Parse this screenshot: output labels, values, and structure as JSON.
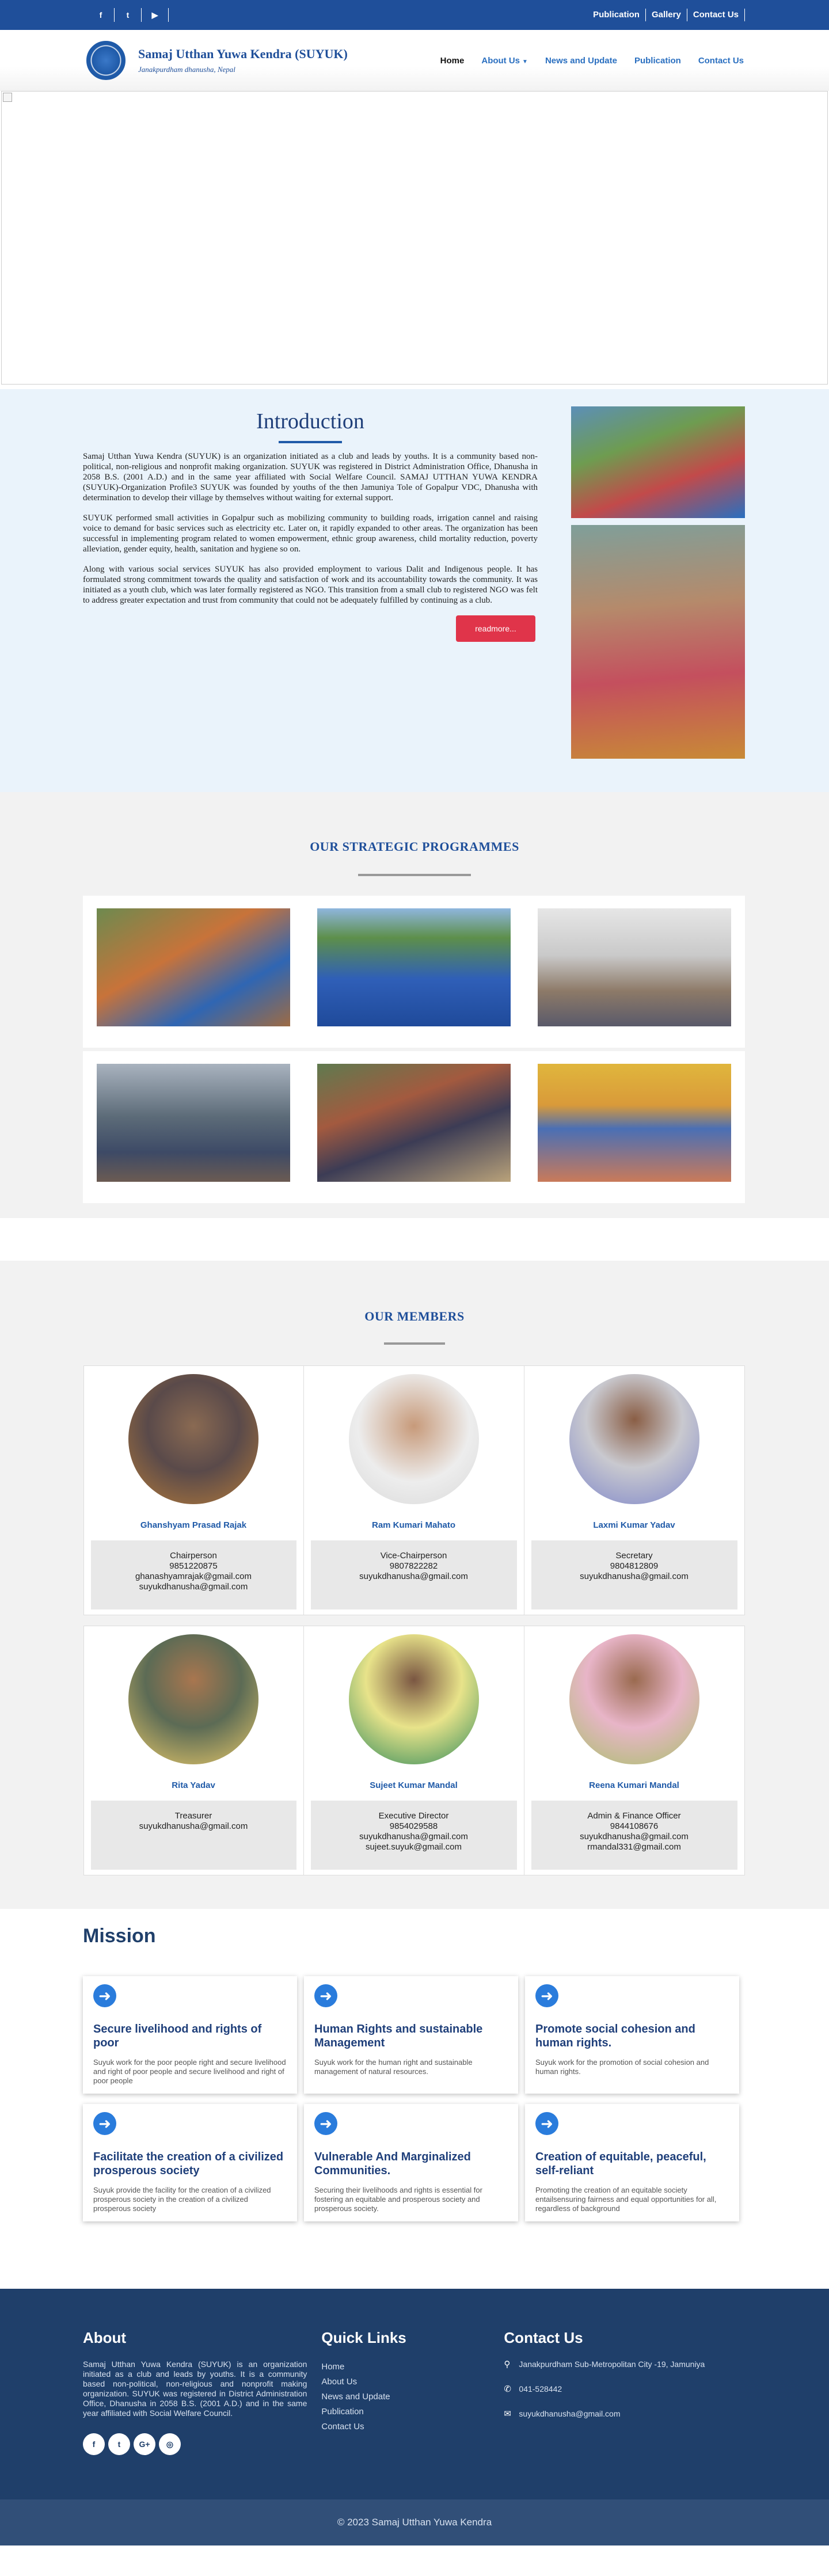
{
  "topbar": {
    "social": [
      {
        "icon": "facebook-icon",
        "glyph": "f"
      },
      {
        "icon": "twitter-icon",
        "glyph": "t"
      },
      {
        "icon": "youtube-icon",
        "glyph": "▶"
      }
    ],
    "links": [
      "Publication",
      "Gallery",
      "Contact Us"
    ]
  },
  "brand": {
    "title": "Samaj Utthan Yuwa Kendra (SUYUK)",
    "subtitle": "Janakpurdham dhanusha, Nepal"
  },
  "nav": {
    "items": [
      "Home",
      "About Us",
      "News and Update",
      "Publication",
      "Contact Us"
    ]
  },
  "intro": {
    "title": "Introduction",
    "paragraphs": [
      "Samaj Utthan Yuwa Kendra (SUYUK) is an organization initiated as a club and leads by youths. It is a community based non-political, non-religious and nonprofit making organization. SUYUK was registered in District Administration Office, Dhanusha in 2058 B.S. (2001 A.D.) and in the same year affiliated with Social Welfare Council. SAMAJ UTTHAN YUWA KENDRA (SUYUK)-Organization Profile3 SUYUK was founded by youths of the then Jamuniya Tole of Gopalpur VDC, Dhanusha with determination to develop their village by themselves without waiting for external support.",
      "SUYUK performed small activities in Gopalpur such as mobilizing community to building roads, irrigation cannel and raising voice to demand for basic services such as electricity etc. Later on, it rapidly expanded to other areas. The organization has been successful in implementing program related to women empowerment, ethnic group awareness, child mortality reduction, poverty alleviation, gender equity, health, sanitation and hygiene so on.",
      "Along with various social services SUYUK has also provided employment to various Dalit and Indigenous people. It has formulated strong commitment towards the quality and satisfaction of work and its accountability towards the community. It was initiated as a youth club, which was later formally registered as NGO. This transition from a small club to registered NGO was felt to address greater expectation and trust from community that could not be adequately fulfilled by continuing as a club."
    ],
    "readmore": "readmore..."
  },
  "programmes": {
    "title": "OUR STRATEGIC PROGRAMMES"
  },
  "members": {
    "title": "OUR MEMBERS",
    "list": [
      {
        "name": "Ghanshyam Prasad Rajak",
        "lines": [
          "Chairperson",
          "9851220875",
          "ghanashyamrajak@gmail.com",
          "suyukdhanusha@gmail.com"
        ]
      },
      {
        "name": "Ram Kumari Mahato",
        "lines": [
          "Vice-Chairperson",
          "9807822282",
          "suyukdhanusha@gmail.com"
        ]
      },
      {
        "name": "Laxmi Kumar Yadav",
        "lines": [
          "Secretary",
          "9804812809",
          "suyukdhanusha@gmail.com"
        ]
      },
      {
        "name": "Rita Yadav",
        "lines": [
          "Treasurer",
          "suyukdhanusha@gmail.com"
        ]
      },
      {
        "name": "Sujeet Kumar Mandal",
        "lines": [
          "Executive Director",
          "9854029588",
          "suyukdhanusha@gmail.com",
          "sujeet.suyuk@gmail.com"
        ]
      },
      {
        "name": "Reena Kumari Mandal",
        "lines": [
          "Admin & Finance Officer",
          "9844108676",
          "suyukdhanusha@gmail.com",
          "rmandal331@gmail.com"
        ]
      }
    ]
  },
  "mission": {
    "title": "Mission",
    "cards": [
      {
        "title": "Secure livelihood and rights of poor",
        "text": "Suyuk work for the poor people right and secure livelihood and right of poor people and secure livelihood and right of poor people"
      },
      {
        "title": "Human Rights and sustainable Management",
        "text": "Suyuk work for the human right and sustainable management of natural resources."
      },
      {
        "title": "Promote social cohesion and human rights.",
        "text": "Suyuk work for the promotion of social cohesion and human rights."
      },
      {
        "title": "Facilitate the creation of a civilized prosperous society",
        "text": "Suyuk provide the facility for the creation of a civilized prosperous society in the creation of a civilized prosperous society"
      },
      {
        "title": "Vulnerable And Marginalized Communities.",
        "text": "Securing their livelihoods and rights is essential for fostering an equitable and prosperous society and prosperous society."
      },
      {
        "title": "Creation of equitable, peaceful, self-reliant",
        "text": "Promoting the creation of an equitable society entailsensuring fairness and equal opportunities for all, regardless of background"
      }
    ]
  },
  "footer": {
    "about_title": "About",
    "about_text": "Samaj Utthan Yuwa Kendra (SUYUK) is an organization initiated as a club and leads by youths. It is a community based non-political, non-religious and nonprofit making organization. SUYUK was registered in District Administration Office, Dhanusha in 2058 B.S. (2001 A.D.) and in the same year affiliated with Social Welfare Council.",
    "social": [
      {
        "icon": "facebook-icon",
        "glyph": "f"
      },
      {
        "icon": "twitter-icon",
        "glyph": "t"
      },
      {
        "icon": "google-plus-icon",
        "glyph": "G+"
      },
      {
        "icon": "instagram-icon",
        "glyph": "◎"
      }
    ],
    "links_title": "Quick Links",
    "links": [
      "Home",
      "About Us",
      "News and Update",
      "Publication",
      "Contact Us"
    ],
    "contact_title": "Contact Us",
    "address": "Janakpurdham Sub-Metropolitan City -19, Jamuniya",
    "phone": "041-528442",
    "email": "suyukdhanusha@gmail.com",
    "copyright": "© 2023 Samaj Utthan Yuwa Kendra"
  }
}
